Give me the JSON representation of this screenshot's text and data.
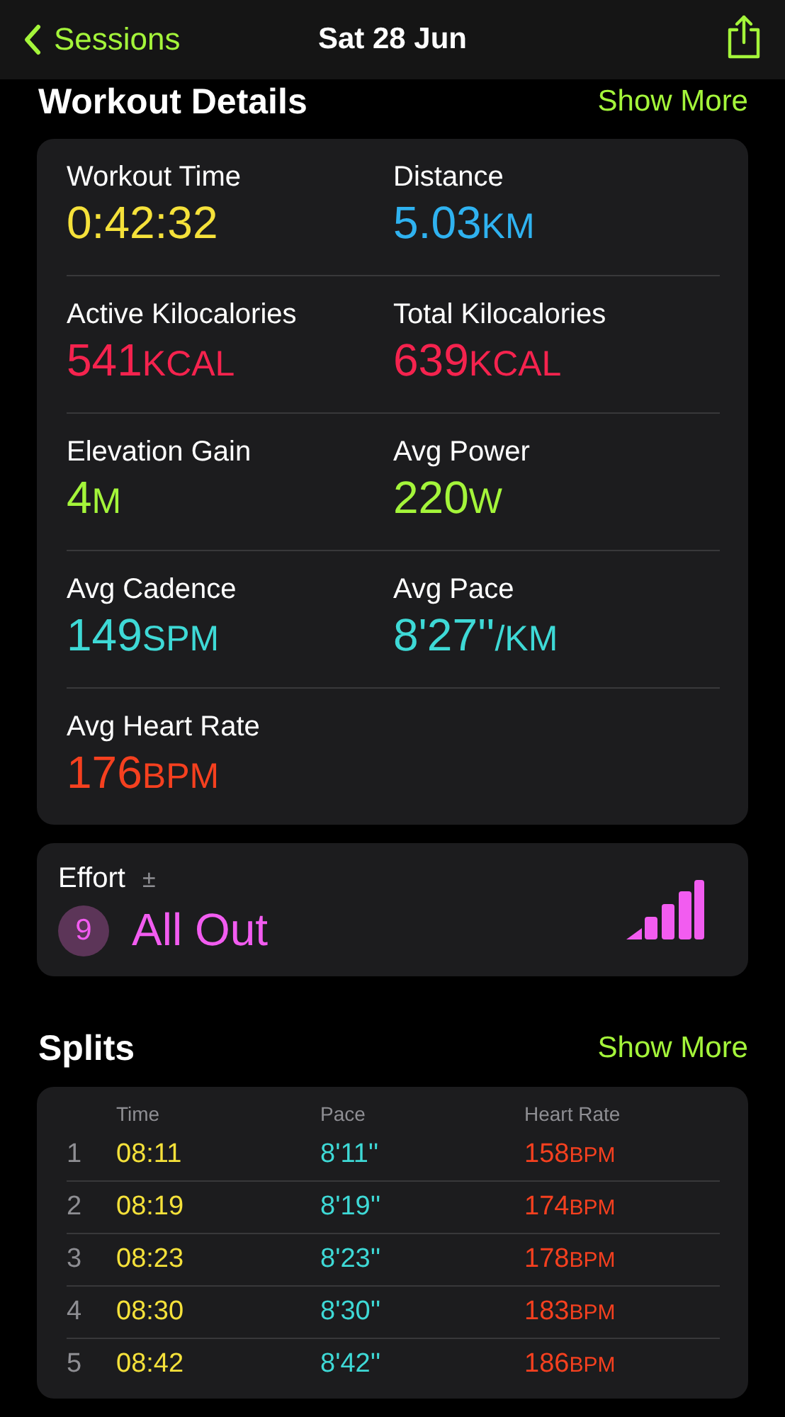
{
  "nav": {
    "back_label": "Sessions",
    "title": "Sat 28 Jun"
  },
  "workout_details": {
    "title": "Workout Details",
    "show_more": "Show More",
    "metrics": [
      {
        "label": "Workout Time",
        "value": "0:42:32",
        "color": "#f5e13a"
      },
      {
        "label": "Distance",
        "value": "5.03",
        "unit": "KM",
        "color": "#2fb2f0"
      },
      {
        "label": "Active Kilocalories",
        "value": "541",
        "unit": "KCAL",
        "color": "#f5234e"
      },
      {
        "label": "Total Kilocalories",
        "value": "639",
        "unit": "KCAL",
        "color": "#f5234e"
      },
      {
        "label": "Elevation Gain",
        "value": "4",
        "unit": "M",
        "color": "#a4f53a"
      },
      {
        "label": "Avg Power",
        "value": "220",
        "unit": "W",
        "color": "#a4f53a"
      },
      {
        "label": "Avg Cadence",
        "value": "149",
        "unit": "SPM",
        "color": "#3ed9d6"
      },
      {
        "label": "Avg Pace",
        "value": "8'27''",
        "unit": "/KM",
        "color": "#3ed9d6"
      },
      {
        "label": "Avg Heart Rate",
        "value": "176",
        "unit": "BPM",
        "color": "#f5401f"
      }
    ]
  },
  "effort": {
    "label": "Effort",
    "adjust": "±",
    "score": "9",
    "rating": "All Out"
  },
  "splits": {
    "title": "Splits",
    "show_more": "Show More",
    "columns": [
      "Time",
      "Pace",
      "Heart Rate"
    ],
    "rows": [
      {
        "number": "1",
        "time": "08:11",
        "pace": "8'11''",
        "heart_rate": "158",
        "unit": "BPM"
      },
      {
        "number": "2",
        "time": "08:19",
        "pace": "8'19''",
        "heart_rate": "174",
        "unit": "BPM"
      },
      {
        "number": "3",
        "time": "08:23",
        "pace": "8'23''",
        "heart_rate": "178",
        "unit": "BPM"
      },
      {
        "number": "4",
        "time": "08:30",
        "pace": "8'30''",
        "heart_rate": "183",
        "unit": "BPM"
      },
      {
        "number": "5",
        "time": "08:42",
        "pace": "8'42''",
        "heart_rate": "186",
        "unit": "BPM"
      }
    ]
  }
}
